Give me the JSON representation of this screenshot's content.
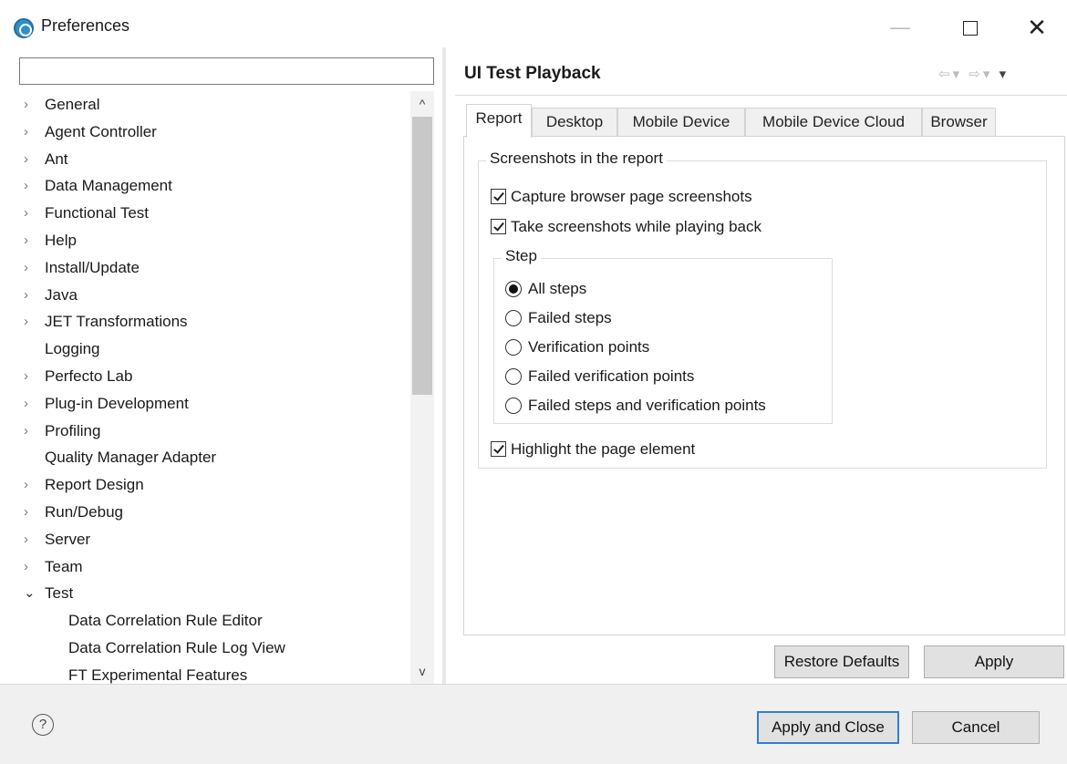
{
  "window": {
    "title": "Preferences",
    "minimize": "—",
    "close": "✕"
  },
  "left": {
    "filter": {
      "value": "",
      "placeholder": ""
    },
    "tree": [
      {
        "label": "General",
        "expandable": true
      },
      {
        "label": "Agent Controller",
        "expandable": true
      },
      {
        "label": "Ant",
        "expandable": true
      },
      {
        "label": "Data Management",
        "expandable": true
      },
      {
        "label": "Functional Test",
        "expandable": true
      },
      {
        "label": "Help",
        "expandable": true
      },
      {
        "label": "Install/Update",
        "expandable": true
      },
      {
        "label": "Java",
        "expandable": true
      },
      {
        "label": "JET Transformations",
        "expandable": true
      },
      {
        "label": "Logging",
        "expandable": false
      },
      {
        "label": "Perfecto Lab",
        "expandable": true
      },
      {
        "label": "Plug-in Development",
        "expandable": true
      },
      {
        "label": "Profiling",
        "expandable": true
      },
      {
        "label": "Quality Manager Adapter",
        "expandable": false
      },
      {
        "label": "Report Design",
        "expandable": true
      },
      {
        "label": "Run/Debug",
        "expandable": true
      },
      {
        "label": "Server",
        "expandable": true
      },
      {
        "label": "Team",
        "expandable": true
      },
      {
        "label": "Test",
        "expandable": true,
        "expanded": true
      },
      {
        "label": "Data Correlation Rule Editor",
        "child": true
      },
      {
        "label": "Data Correlation Rule Log View",
        "child": true
      },
      {
        "label": "FT Experimental Features",
        "child": true
      }
    ]
  },
  "right": {
    "title": "UI Test Playback",
    "tabs": [
      "Report",
      "Desktop",
      "Mobile Device",
      "Mobile Device Cloud",
      "Browser"
    ],
    "active_tab": "Report",
    "group_title": "Screenshots in the report",
    "capture_label": "Capture browser page screenshots",
    "capture_checked": true,
    "take_label": "Take screenshots while playing back",
    "take_checked": true,
    "step_title": "Step",
    "step_options": [
      {
        "label": "All steps",
        "selected": true
      },
      {
        "label": "Failed steps",
        "selected": false
      },
      {
        "label": "Verification points",
        "selected": false
      },
      {
        "label": "Failed verification points",
        "selected": false
      },
      {
        "label": "Failed steps and verification points",
        "selected": false
      }
    ],
    "highlight_label": "Highlight the page element",
    "highlight_checked": true,
    "restore_defaults": "Restore Defaults",
    "apply": "Apply"
  },
  "bottom": {
    "help": "?",
    "apply_and_close": "Apply and Close",
    "cancel": "Cancel"
  }
}
